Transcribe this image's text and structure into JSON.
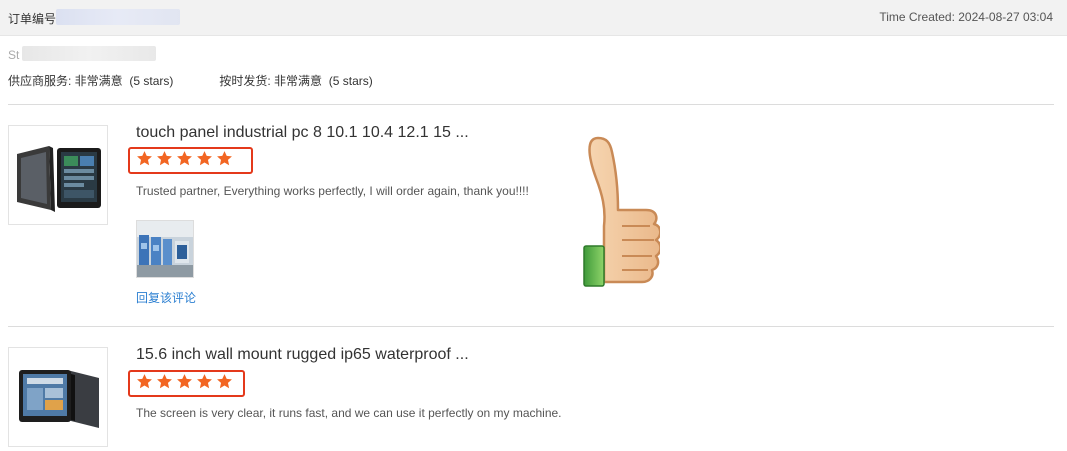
{
  "header": {
    "order_number_label": "订单编号",
    "time_created": "Time Created: 2024-08-27 03:04"
  },
  "store": {
    "name_prefix": "St"
  },
  "ratings": {
    "supplier_service_label": "供应商服务: ",
    "supplier_service_value": "非常满意",
    "supplier_service_stars": "(5 stars)",
    "on_time_delivery_label": "按时发货: ",
    "on_time_delivery_value": "非常满意",
    "on_time_delivery_stars": "(5 stars)"
  },
  "reviews": [
    {
      "product_title": "touch panel industrial pc 8 10.1 10.4 12.1 15 ...",
      "rating": 5,
      "text": "Trusted partner, Everything works perfectly, I will order again, thank you!!!!",
      "reply_label": "回复该评论"
    },
    {
      "product_title": "15.6 inch wall mount rugged ip65 waterproof ...",
      "rating": 5,
      "text": "The screen is very clear, it runs fast, and we can use it perfectly on my machine."
    }
  ],
  "colors": {
    "star": "#f26522",
    "highlight_border": "#e4391b",
    "link": "#2b7fd1"
  },
  "icons": {
    "star": "star-icon",
    "thumbs_up": "thumbs-up-icon"
  }
}
